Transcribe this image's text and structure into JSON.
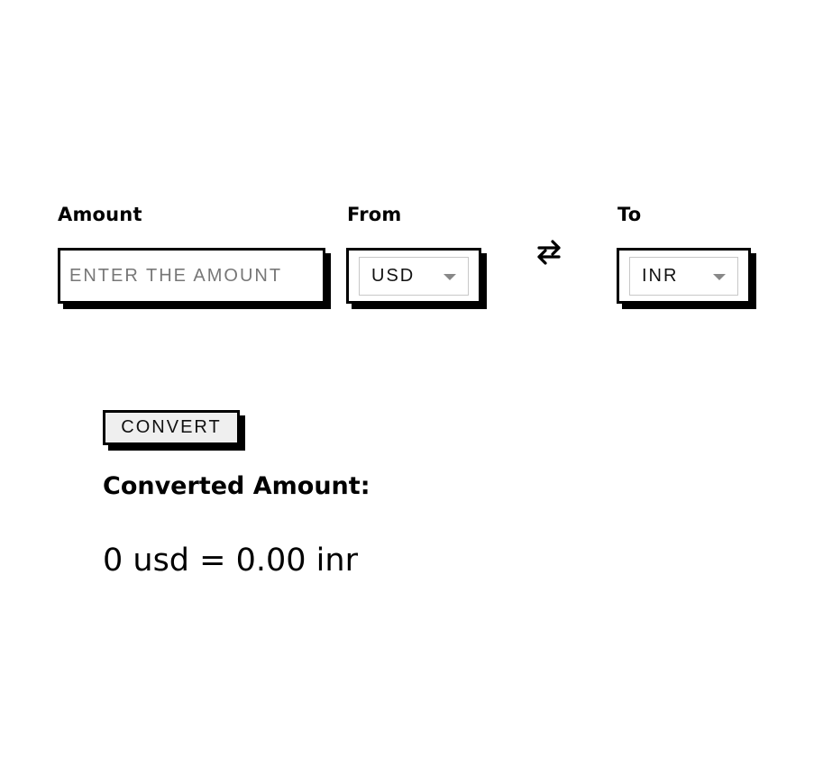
{
  "form": {
    "amount_label": "Amount",
    "amount_placeholder": "ENTER THE AMOUNT",
    "amount_value": "",
    "from_label": "From",
    "from_value": "USD",
    "to_label": "To",
    "to_value": "INR",
    "swap_icon": "swap-arrows-icon"
  },
  "convert_button": "CONVERT",
  "result": {
    "title": "Converted Amount:",
    "text": "0 usd = 0.00 inr"
  }
}
